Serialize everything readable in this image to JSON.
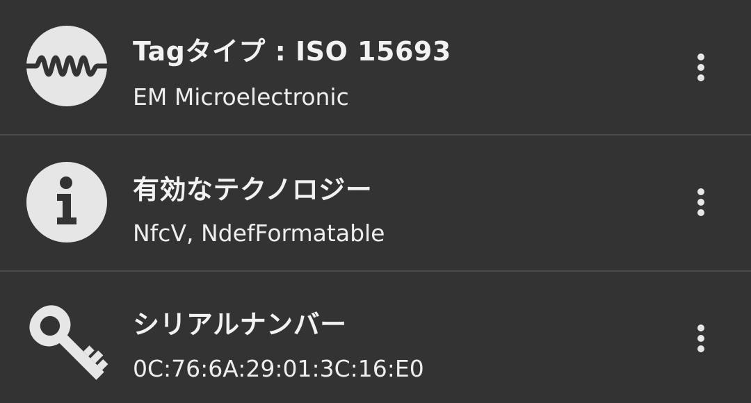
{
  "colors": {
    "background": "#333333",
    "divider": "#4a4a4a",
    "text_primary": "#f2f2f2",
    "icon_fill": "#e6e6e6"
  },
  "rows": [
    {
      "icon": "waveform-circle-icon",
      "title": "Tagタイプ : ISO 15693",
      "subtitle": "EM Microelectronic",
      "menu_icon": "more-vert-icon"
    },
    {
      "icon": "info-circle-icon",
      "title": "有効なテクノロジー",
      "subtitle": "NfcV, NdefFormatable",
      "menu_icon": "more-vert-icon"
    },
    {
      "icon": "key-icon",
      "title": "シリアルナンバー",
      "subtitle": "0C:76:6A:29:01:3C:16:E0",
      "menu_icon": "more-vert-icon"
    }
  ]
}
